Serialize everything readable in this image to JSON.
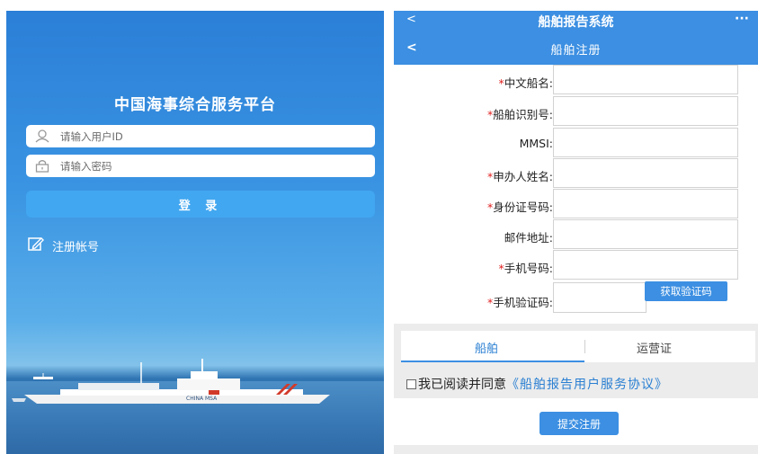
{
  "login": {
    "title": "中国海事综合服务平台",
    "user_placeholder": "请输入用户ID",
    "password_placeholder": "请输入密码",
    "login_button": "登 录",
    "register_link": "注册帐号",
    "ship_text": "CHINA MSA"
  },
  "register": {
    "app_title": "船舶报告系统",
    "more_label": "···",
    "back_label": "<",
    "page_title": "船舶注册",
    "fields": [
      {
        "label": "中文船名:",
        "required": "*"
      },
      {
        "label": "船舶识别号:",
        "required": "*"
      },
      {
        "label": "MMSI:",
        "required": ""
      },
      {
        "label": "申办人姓名:",
        "required": "*"
      },
      {
        "label": "身份证号码:",
        "required": "*"
      },
      {
        "label": "邮件地址:",
        "required": ""
      },
      {
        "label": "手机号码:",
        "required": "*"
      },
      {
        "label": "手机验证码:",
        "required": "*"
      }
    ],
    "get_code_button": "获取验证码",
    "tabs": [
      "船舶",
      "运营证"
    ],
    "agree_text": "我已阅读并同意",
    "agreement_link": "《船舶报告用户服务协议》",
    "submit_button": "提交注册"
  },
  "colors": {
    "primary_blue": "#3c8fe2",
    "required_red": "#e02020",
    "link_blue": "#2a7fd2"
  }
}
